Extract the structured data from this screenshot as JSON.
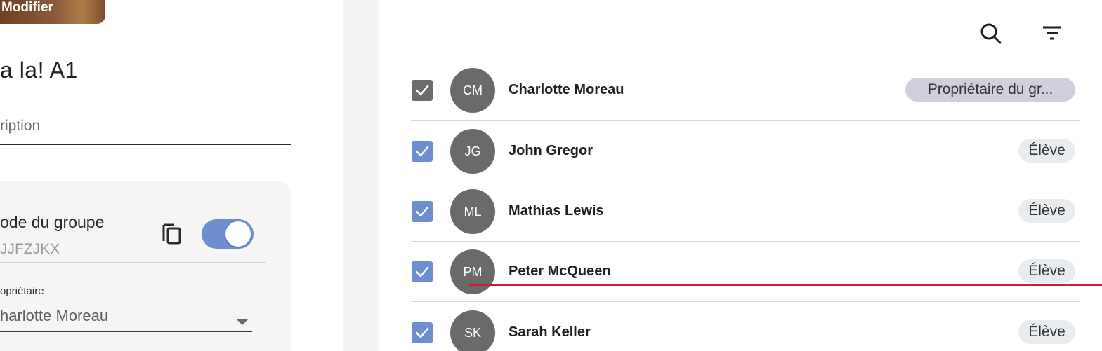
{
  "left_panel": {
    "modify_label": "Modifier",
    "group_name": "a la! A1",
    "description_placeholder": "ription",
    "group_code_label": "ode du groupe",
    "group_code_value": "JJFZJKX",
    "group_code_toggle_on": true,
    "owner_label": "opriétaire",
    "owner_value": "harlotte Moreau"
  },
  "toolbar": {
    "search_icon": "search-icon",
    "filter_icon": "filter-icon"
  },
  "members": [
    {
      "initials": "CM",
      "name": "Charlotte Moreau",
      "role": "Propriétaire du gr...",
      "checked": true,
      "checkbox_color": "#6b6b6b"
    },
    {
      "initials": "JG",
      "name": "John Gregor",
      "role": "Élève",
      "checked": true,
      "checkbox_color": "#6d8fcf"
    },
    {
      "initials": "ML",
      "name": "Mathias Lewis",
      "role": "Élève",
      "checked": true,
      "checkbox_color": "#6d8fcf"
    },
    {
      "initials": "PM",
      "name": "Peter McQueen",
      "role": "Élève",
      "checked": true,
      "checkbox_color": "#6d8fcf"
    },
    {
      "initials": "SK",
      "name": "Sarah Keller",
      "role": "Élève",
      "checked": true,
      "checkbox_color": "#6d8fcf"
    }
  ],
  "colors": {
    "accent": "#6d8fcf",
    "avatar_bg": "#6a6a6a",
    "highlight_line": "#c8202e"
  }
}
